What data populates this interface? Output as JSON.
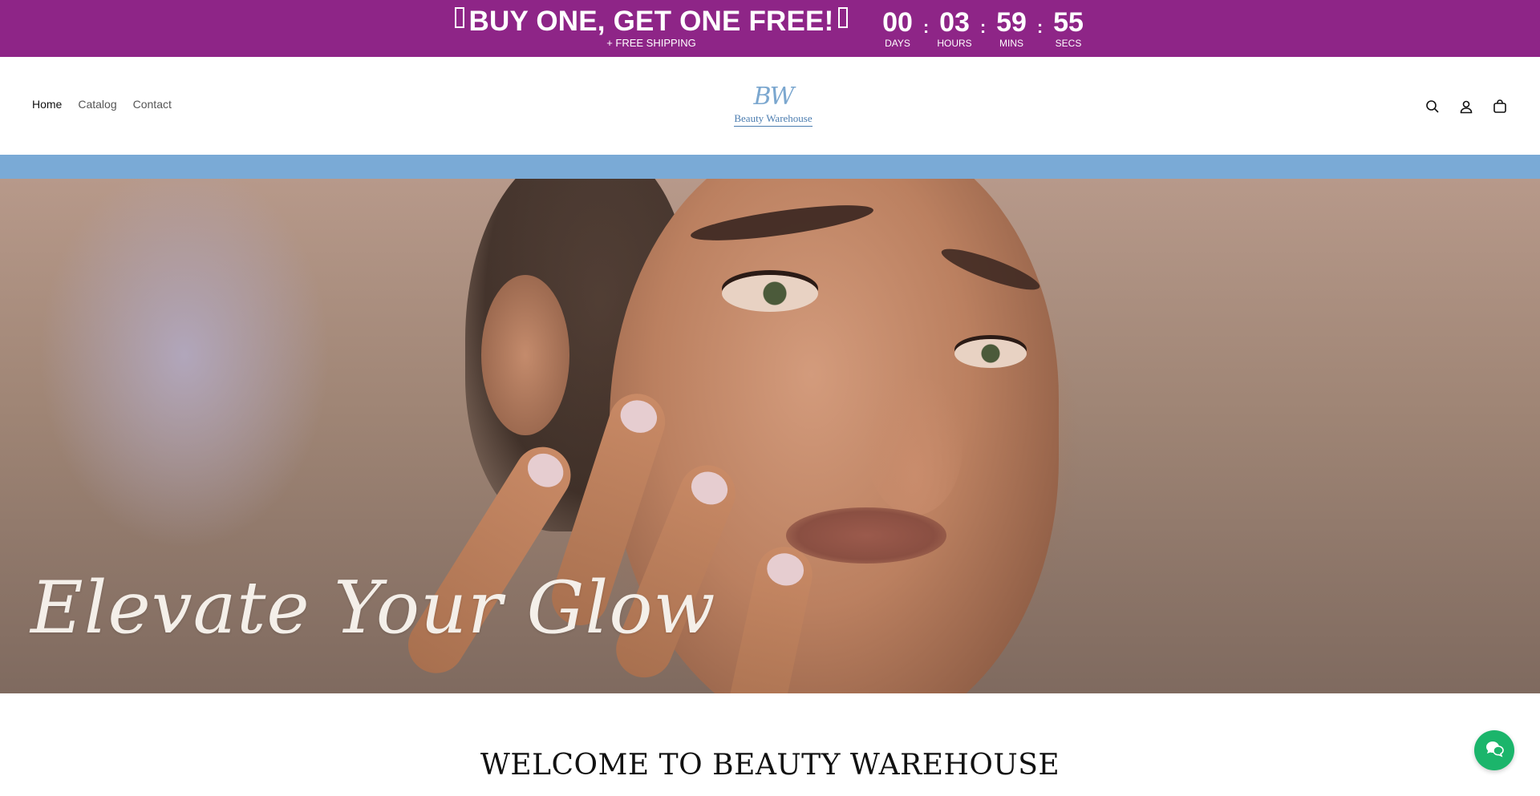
{
  "promo": {
    "title": "BUY ONE, GET ONE FREE!",
    "subtitle": "+ FREE SHIPPING",
    "countdown": [
      {
        "value": "00",
        "label": "DAYS"
      },
      {
        "value": "03",
        "label": "HOURS"
      },
      {
        "value": "59",
        "label": "MINS"
      },
      {
        "value": "55",
        "label": "SECS"
      }
    ],
    "separator": ":",
    "background_color": "#8e2587"
  },
  "nav": {
    "items": [
      {
        "label": "Home",
        "active": true
      },
      {
        "label": "Catalog",
        "active": false
      },
      {
        "label": "Contact",
        "active": false
      }
    ]
  },
  "logo": {
    "mark": "BW",
    "text": "Beauty Warehouse"
  },
  "header_icons": [
    "search-icon",
    "account-icon",
    "cart-icon"
  ],
  "strip_color": "#7aaad6",
  "hero": {
    "title": "Elevate Your Glow"
  },
  "welcome": {
    "heading": "WELCOME TO BEAUTY WAREHOUSE"
  },
  "chat": {
    "icon": "chat-icon",
    "color": "#1bb56b"
  }
}
